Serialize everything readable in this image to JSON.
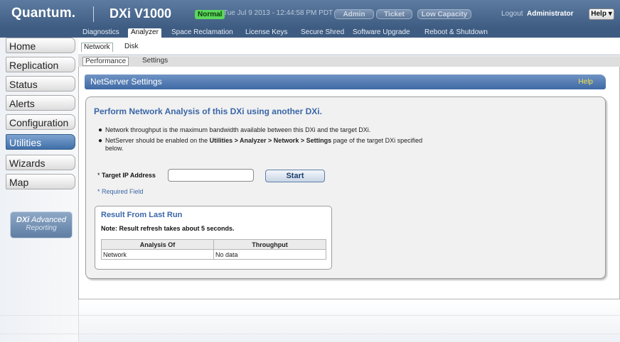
{
  "header": {
    "brand": "Quantum.",
    "model": "DXi V1000",
    "status": "Normal",
    "datetime": "Tue Jul 9 2013 - 12:44:58 PM PDT",
    "pills": [
      "Admin",
      "Ticket",
      "Low Capacity"
    ],
    "logout": "Logout",
    "user": "Administrator",
    "help": "Help ▾"
  },
  "topmenu": [
    "Diagnostics",
    "Analyzer",
    "Space Reclamation",
    "License Keys",
    "Secure Shred",
    "Software Upgrade",
    "Reboot & Shutdown"
  ],
  "sidebar": {
    "items": [
      "Home",
      "Replication",
      "Status",
      "Alerts",
      "Configuration",
      "Utilities",
      "Wizards",
      "Map"
    ],
    "reporting_line1_bold": "DXi",
    "reporting_line1": " Advanced",
    "reporting_line2": "Reporting"
  },
  "tabs1": [
    "Network",
    "Disk"
  ],
  "tabs2": [
    "Performance",
    "Settings"
  ],
  "panel": {
    "header": "NetServer Settings",
    "help": "Help",
    "title": "Perform Network Analysis of this DXi using another DXi.",
    "bullet1": "Network throughput is the maximum bandwidth available between this DXi and the target DXi.",
    "bullet2_pre": "NetServer should be enabled on the ",
    "bullet2_bold": "Utilities > Analyzer > Network > Settings",
    "bullet2_post": " page of the target DXi specified below.",
    "target_label": "Target IP Address",
    "target_value": "",
    "start_label": "Start",
    "required": "* Required Field"
  },
  "result": {
    "title": "Result From Last Run",
    "note": "Note: Result refresh takes about 5 seconds.",
    "columns": [
      "Analysis Of",
      "Throughput"
    ],
    "rows": [
      [
        "Network",
        "No data"
      ]
    ]
  }
}
